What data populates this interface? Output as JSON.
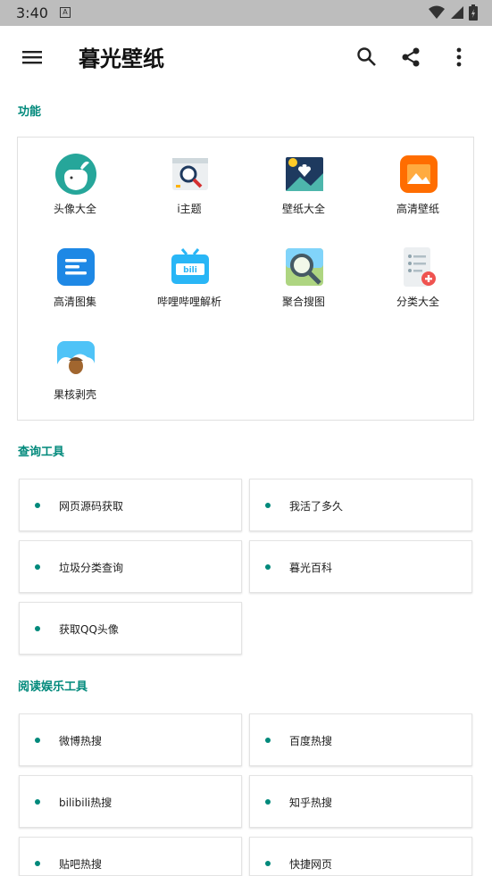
{
  "status_bar": {
    "time": "3:40",
    "notification_letter": "A"
  },
  "app_bar": {
    "title": "暮光壁纸"
  },
  "sections": {
    "functions": {
      "label": "功能",
      "items": [
        {
          "label": "头像大全",
          "icon": "avatar-app-icon"
        },
        {
          "label": "i主题",
          "icon": "theme-app-icon"
        },
        {
          "label": "壁纸大全",
          "icon": "wallpaper-app-icon"
        },
        {
          "label": "高清壁纸",
          "icon": "hd-wallpaper-app-icon"
        },
        {
          "label": "高清图集",
          "icon": "hd-gallery-app-icon"
        },
        {
          "label": "哔哩哔哩解析",
          "icon": "bilibili-app-icon"
        },
        {
          "label": "聚合搜图",
          "icon": "image-search-app-icon"
        },
        {
          "label": "分类大全",
          "icon": "category-app-icon"
        },
        {
          "label": "果核剥壳",
          "icon": "guohe-app-icon"
        }
      ]
    },
    "query_tools": {
      "label": "查询工具",
      "items": [
        "网页源码获取",
        "我活了多久",
        "垃圾分类查询",
        "暮光百科",
        "获取QQ头像"
      ]
    },
    "reading_tools": {
      "label": "阅读娱乐工具",
      "items": [
        "微博热搜",
        "百度热搜",
        "bilibili热搜",
        "知乎热搜",
        "贴吧热搜",
        "快捷网页"
      ]
    }
  },
  "colors": {
    "accent": "#00897b",
    "status_bar": "#bdbdbd"
  }
}
